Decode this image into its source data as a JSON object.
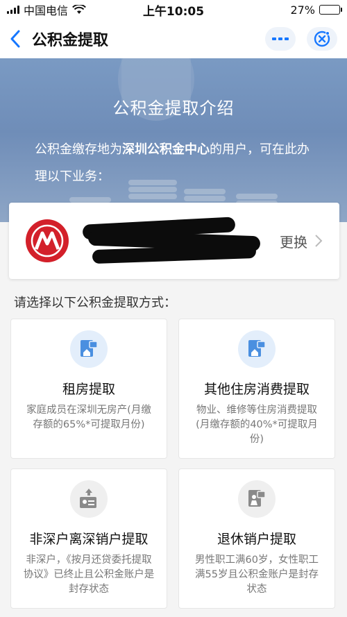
{
  "status_bar": {
    "carrier": "中国电信",
    "time": "上午10:05",
    "battery": "27%",
    "battery_level": 0.27
  },
  "nav": {
    "title": "公积金提取",
    "more_icon": "more-dots-icon",
    "close_icon": "close-circle-icon"
  },
  "hero": {
    "title": "公积金提取介绍",
    "desc_pre": "公积金缴存地为",
    "desc_strong": "深圳公积金中心",
    "desc_post": "的用户，可在此办理以下业务："
  },
  "bank": {
    "change_label": "更换"
  },
  "section_label": "请选择以下公积金提取方式：",
  "options": [
    {
      "title": "租房提取",
      "desc": "家庭成员在深圳无房产(月缴存额的65%*可提取月份)",
      "icon": "rent-house-icon",
      "color": "#4a8fe0",
      "bg": "#e3eefb"
    },
    {
      "title": "其他住房消费提取",
      "desc": "物业、维修等住房消费提取(月缴存额的40%*可提取月份)",
      "icon": "housing-consume-icon",
      "color": "#4a8fe0",
      "bg": "#e3eefb"
    },
    {
      "title": "非深户离深销户提取",
      "desc": "非深户，《按月还贷委托提取协议》已终止且公积金账户是封存状态",
      "icon": "account-transfer-icon",
      "color": "#8a8a8a",
      "bg": "#efefef"
    },
    {
      "title": "退休销户提取",
      "desc": "男性职工满60岁，女性职工满55岁且公积金账户是封存状态",
      "icon": "retire-icon",
      "color": "#8a8a8a",
      "bg": "#efefef"
    }
  ]
}
